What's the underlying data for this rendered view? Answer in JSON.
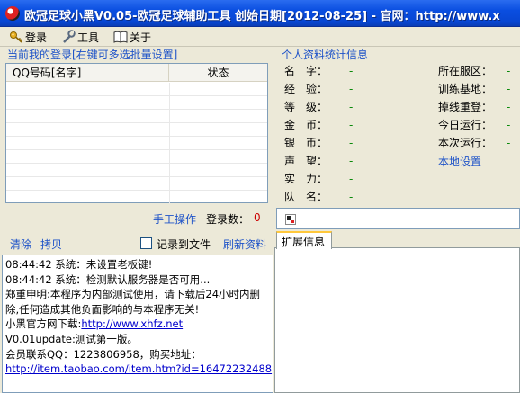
{
  "window": {
    "title": "欧冠足球小黑V0.05-欧冠足球辅助工具 创始日期[2012-08-25] - 官网：http://www.x"
  },
  "menu": {
    "login": "登录",
    "tools": "工具",
    "about": "关于"
  },
  "login_section": {
    "title": "当前我的登录[右键可多选批量设置]",
    "col_qq": "QQ号码[名字]",
    "col_status": "状态",
    "manual_op": "手工操作",
    "login_count_label": "登录数：",
    "login_count": "0"
  },
  "log_toolbar": {
    "clear": "清除",
    "copy": "拷贝",
    "record_to_file": "记录到文件",
    "refresh": "刷新资料"
  },
  "log_lines": [
    {
      "text": "08:44:42 系统：未设置老板键!"
    },
    {
      "text": "08:44:42 系统：检测默认服务器是否可用..."
    },
    {
      "text": "郑重申明:本程序为内部测试使用，请下载后24小时内删"
    },
    {
      "text": "除,任何造成其他负面影响的与本程序无关!"
    },
    {
      "prefix": "小黑官方网下载:",
      "link": "http://www.xhfz.net"
    },
    {
      "text": "V0.01update:测试第一版。"
    },
    {
      "text": "会员联系QQ：1223806958，购买地址："
    },
    {
      "link": "http://item.taobao.com/item.htm?id=16472232488"
    }
  ],
  "profile": {
    "title": "个人资料统计信息",
    "left": [
      {
        "label": "名　字：",
        "value": "-"
      },
      {
        "label": "经　验：",
        "value": "-"
      },
      {
        "label": "等　级：",
        "value": "-"
      },
      {
        "label": "金　币：",
        "value": "-"
      },
      {
        "label": "银　币：",
        "value": "-"
      },
      {
        "label": "声　望：",
        "value": "-"
      },
      {
        "label": "实　力：",
        "value": "-"
      },
      {
        "label": "队　名：",
        "value": "-"
      }
    ],
    "right": [
      {
        "label": "所在服区：",
        "value": "-"
      },
      {
        "label": "训练基地：",
        "value": "-"
      },
      {
        "label": "掉线重登：",
        "value": "-"
      },
      {
        "label": "今日运行：",
        "value": "-"
      },
      {
        "label": "本次运行：",
        "value": "-"
      }
    ],
    "local_settings": "本地设置"
  },
  "ext_tab": {
    "label": "扩展信息"
  },
  "colors": {
    "title_blue": "#0a4ee0",
    "link_blue": "#1d52c8",
    "count_red": "#cc0000",
    "value_green": "#0a8a0a"
  }
}
